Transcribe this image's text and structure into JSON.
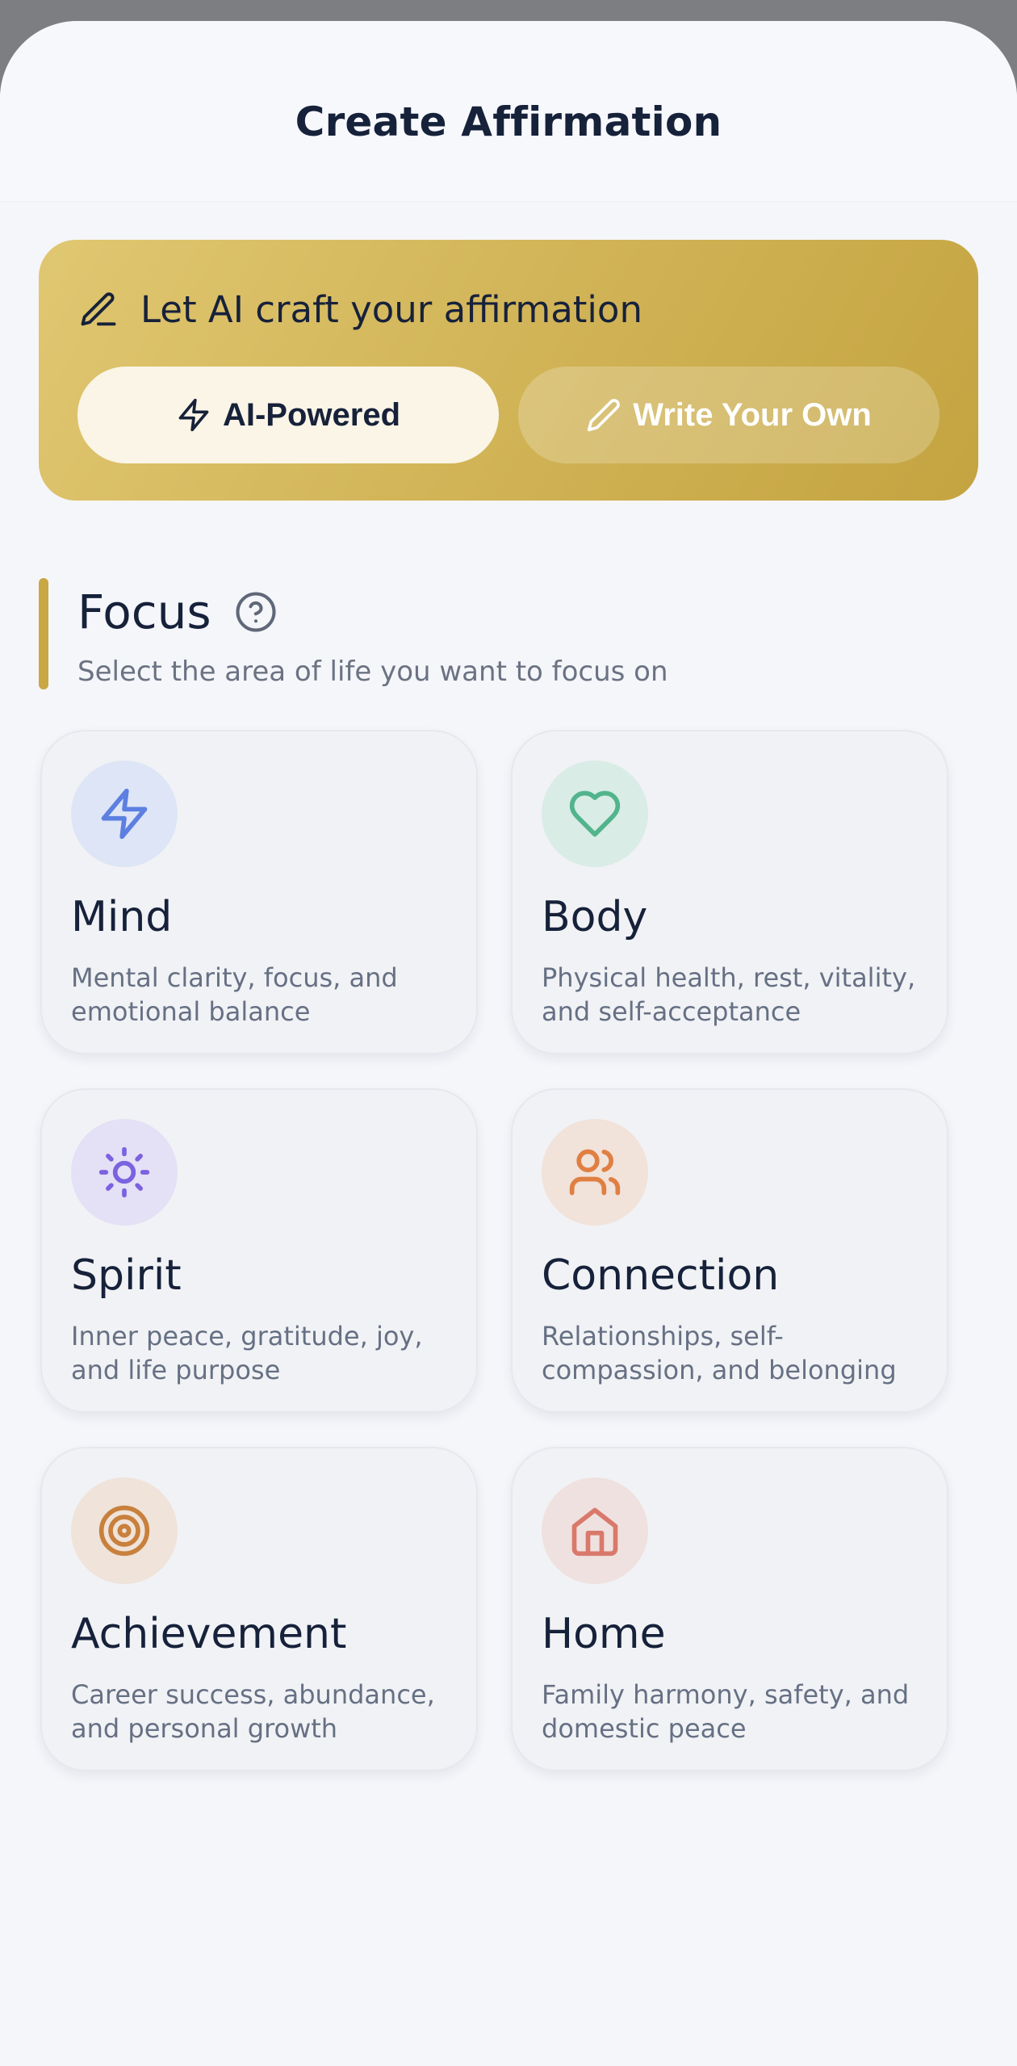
{
  "header": {
    "title": "Create Affirmation"
  },
  "mode": {
    "heading": "Let AI craft your affirmation",
    "heading_icon": "pencil-line-icon",
    "ai_label": "AI-Powered",
    "ai_icon": "lightning-icon",
    "own_label": "Write Your Own",
    "own_icon": "pencil-icon",
    "selected": "AI-Powered",
    "colors": {
      "gradient_start": "#e0c771",
      "gradient_end": "#c4a440"
    }
  },
  "focus": {
    "title": "Focus",
    "subtitle": "Select the area of life you want to focus on",
    "help_icon": "help-circle-icon",
    "accent": "#c9a742",
    "cards": [
      {
        "title": "Mind",
        "desc": "Mental clarity, focus, and emotional balance",
        "icon": "lightning-icon",
        "color": "#5c7fe0",
        "bg": "#dde5f6"
      },
      {
        "title": "Body",
        "desc": "Physical health, rest, vitality, and self-acceptance",
        "icon": "heart-icon",
        "color": "#52b48c",
        "bg": "#d9ece6"
      },
      {
        "title": "Spirit",
        "desc": "Inner peace, gratitude, joy, and life purpose",
        "icon": "sun-icon",
        "color": "#7b62e0",
        "bg": "#e4e0f5"
      },
      {
        "title": "Connection",
        "desc": "Relationships, self-compassion, and belonging",
        "icon": "users-icon",
        "color": "#e07f42",
        "bg": "#f1e2da"
      },
      {
        "title": "Achievement",
        "desc": "Career success, abundance, and personal growth",
        "icon": "target-icon",
        "color": "#c8803c",
        "bg": "#efe3da"
      },
      {
        "title": "Home",
        "desc": "Family harmony, safety, and domestic peace",
        "icon": "home-icon",
        "color": "#d9796b",
        "bg": "#efe1e0"
      }
    ]
  }
}
